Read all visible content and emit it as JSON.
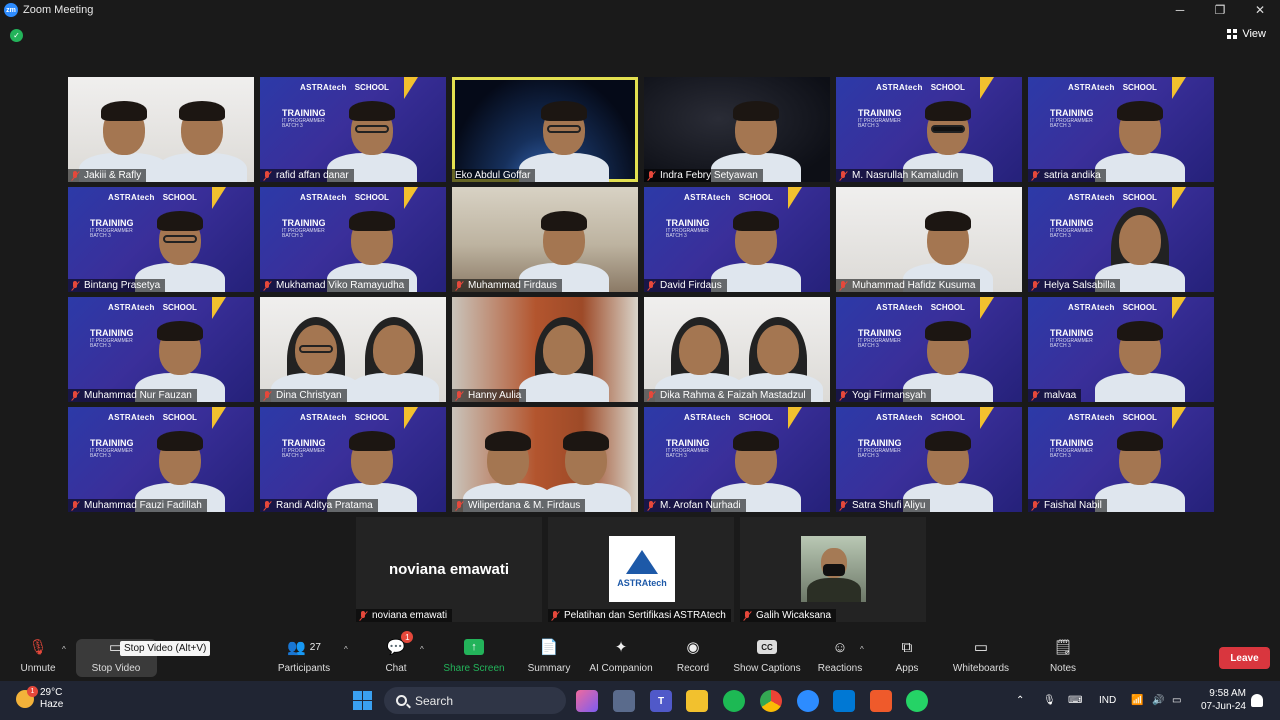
{
  "window": {
    "title": "Zoom Meeting",
    "logo_text": "zm",
    "minimize": "─",
    "maximize": "❐",
    "close": "✕"
  },
  "view": {
    "label": "View"
  },
  "tile_brand": {
    "company": "ASTRAtech",
    "school": "SCHOOL",
    "training": "TRAINING",
    "training_sub": "IT PROGRAMMER",
    "batch": "BATCH 3"
  },
  "participants_grid": [
    {
      "name": "Jakiii & Rafly"
    },
    {
      "name": "rafid affan danar"
    },
    {
      "name": "Eko Abdul Goffar"
    },
    {
      "name": "Indra Febry Setyawan"
    },
    {
      "name": "M. Nasrullah Kamaludin"
    },
    {
      "name": "satria andika"
    },
    {
      "name": "Bintang Prasetya"
    },
    {
      "name": "Mukhamad Viko Ramayudha"
    },
    {
      "name": "Muhammad Firdaus"
    },
    {
      "name": "David Firdaus"
    },
    {
      "name": "Muhammad Hafidz Kusuma"
    },
    {
      "name": "Helya Salsabilla"
    },
    {
      "name": "Muhammad Nur Fauzan"
    },
    {
      "name": "Dina Christyan"
    },
    {
      "name": "Hanny Aulia"
    },
    {
      "name": "Dika Rahma & Faizah Mastadzul"
    },
    {
      "name": "Yogi Firmansyah"
    },
    {
      "name": "malvaa"
    },
    {
      "name": "Muhammad Fauzi Fadillah"
    },
    {
      "name": "Randi Aditya Pratama"
    },
    {
      "name": "Wiliperdana & M. Firdaus"
    },
    {
      "name": "M. Arofan Nurhadi"
    },
    {
      "name": "Satra Shufi Aliyu"
    },
    {
      "name": "Faishal Nabil"
    }
  ],
  "bottom_tiles": [
    {
      "display": "noviana emawati",
      "name": "noviana emawati"
    },
    {
      "logo_text": "ASTRAtech",
      "name": "Pelatihan dan Sertifikasi ASTRAtech"
    },
    {
      "name": "Galih Wicaksana"
    }
  ],
  "toolbar": {
    "unmute": "Unmute",
    "stop_video": "Stop Video",
    "tooltip": "Stop Video (Alt+V)",
    "participants": "Participants",
    "participants_count": "27",
    "chat": "Chat",
    "chat_badge": "1",
    "share_screen": "Share Screen",
    "summary": "Summary",
    "ai_companion": "AI Companion",
    "record": "Record",
    "show_captions": "Show Captions",
    "cc": "CC",
    "reactions": "Reactions",
    "apps": "Apps",
    "whiteboards": "Whiteboards",
    "notes": "Notes",
    "leave": "Leave"
  },
  "taskbar": {
    "temperature": "29°C",
    "weather": "Haze",
    "weather_badge": "1",
    "search": "Search",
    "language": "IND",
    "time": "9:58 AM",
    "date": "07-Jun-24"
  },
  "colors": {
    "accent_green": "#23b35a",
    "leave_red": "#d9363e",
    "active_speaker": "#e3e050",
    "zoom_blue": "#2d8cff"
  }
}
